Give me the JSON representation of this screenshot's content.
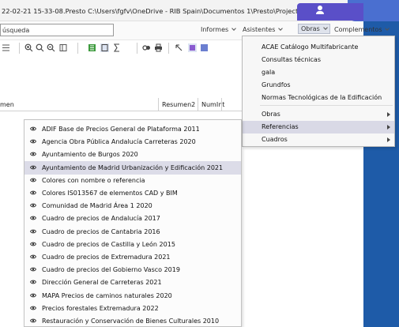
{
  "window": {
    "title": "22-02-21 15-33-08.Presto C:\\Users\\fgfv\\OneDrive - RIB Spain\\Documentos 1\\Presto\\Project"
  },
  "search": {
    "value": "úsqueda",
    "placeholder": ""
  },
  "menubar": [
    {
      "label": "Informes"
    },
    {
      "label": "Asistentes"
    },
    {
      "label": "Obras"
    },
    {
      "label": "Complementos"
    }
  ],
  "columns": {
    "resumen": "men",
    "resumen2": "Resumen2",
    "numint": "NumInt"
  },
  "obras_menu": {
    "top_items": [
      {
        "label": "ACAE Catálogo Multifabricante"
      },
      {
        "label": "Consultas técnicas"
      },
      {
        "label": "gala"
      },
      {
        "label": "Grundfos"
      },
      {
        "label": "Normas Tecnológicas de la Edificación"
      }
    ],
    "sub_items": [
      {
        "label": "Obras"
      },
      {
        "label": "Referencias"
      },
      {
        "label": "Cuadros"
      }
    ],
    "highlighted": "Referencias"
  },
  "referencias_submenu": {
    "items": [
      {
        "label": "ADIF Base de Precios General de Plataforma 2011"
      },
      {
        "label": "Agencia Obra Pública Andalucía Carreteras 2020"
      },
      {
        "label": "Ayuntamiento de Burgos 2020"
      },
      {
        "label": "Ayuntamiento de Madrid Urbanización y Edificación 2021"
      },
      {
        "label": "Colores con nombre o referencia"
      },
      {
        "label": "Colores IS013567 de elementos CAD y BIM"
      },
      {
        "label": "Comunidad de Madrid Área 1 2020"
      },
      {
        "label": "Cuadro de precios de Andalucía 2017"
      },
      {
        "label": "Cuadro de precios de Cantabria 2016"
      },
      {
        "label": "Cuadro de precios de Castilla y León 2015"
      },
      {
        "label": "Cuadro de precios de Extremadura 2021"
      },
      {
        "label": "Cuadro de precios del Gobierno Vasco 2019"
      },
      {
        "label": "Dirección General de Carreteras 2021"
      },
      {
        "label": "MAPA Precios de caminos naturales 2020"
      },
      {
        "label": "Precios forestales Extremadura 2022"
      },
      {
        "label": "Restauración y Conservación de Bienes Culturales 2010"
      }
    ],
    "highlighted": "Ayuntamiento de Madrid Urbanización y Edificación 2021"
  },
  "colors": {
    "accent": "#5a4fc8",
    "menu_highlight": "#d9d9e6",
    "desktop_blue": "#1e5ba8"
  }
}
